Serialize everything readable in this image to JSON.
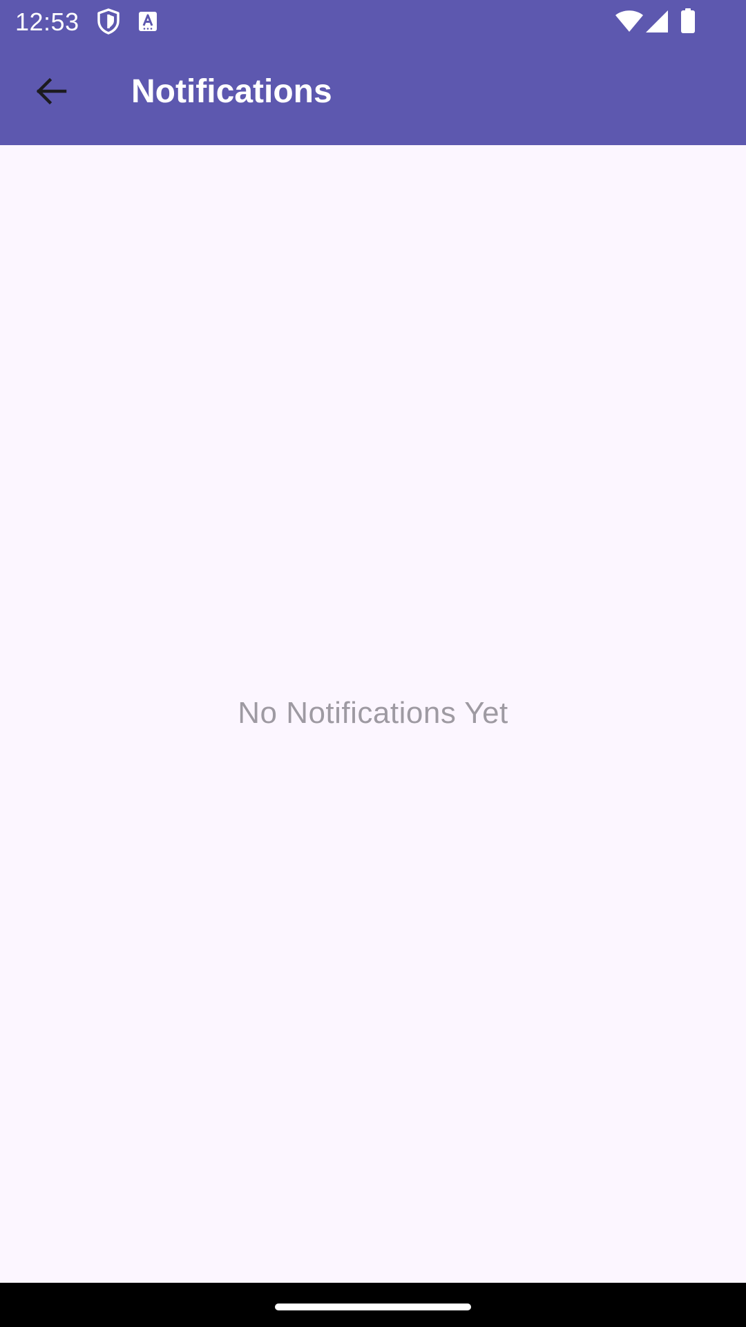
{
  "status_bar": {
    "time": "12:53",
    "icons": [
      "shield-icon",
      "text-a-icon",
      "wifi-icon",
      "cellular-signal-icon",
      "battery-icon"
    ]
  },
  "app_bar": {
    "title": "Notifications",
    "back_icon": "arrow-back-icon"
  },
  "content": {
    "empty_message": "No Notifications Yet"
  },
  "colors": {
    "primary": "#5D58AF",
    "background": "#FCF6FF",
    "on_primary": "#FFFFFF",
    "empty_text": "#9E9AA2",
    "back_icon": "#1C1B1F",
    "nav_bar": "#000000"
  }
}
